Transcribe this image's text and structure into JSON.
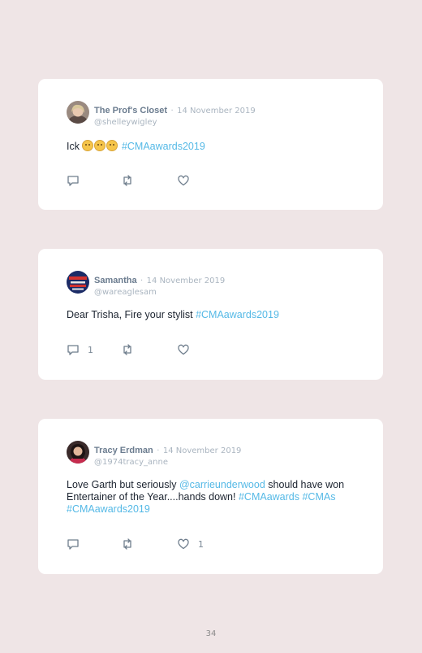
{
  "tweets": [
    {
      "name": "The Prof's Closet",
      "date": "14 November 2019",
      "handle": "@shelleywigley",
      "text_before": "Ick ",
      "emoji_names": [
        "confused-face-emoji",
        "confused-face-emoji",
        "confused-face-emoji"
      ],
      "hashtag": "#CMAawards2019",
      "reply_count": "",
      "retweet_count": "",
      "like_count": ""
    },
    {
      "name": "Samantha",
      "date": "14 November 2019",
      "handle": "@wareaglesam",
      "text_before": "Dear Trisha, Fire your stylist ",
      "hashtag": "#CMAawards2019",
      "reply_count": "1",
      "retweet_count": "",
      "like_count": ""
    },
    {
      "name": "Tracy Erdman",
      "date": "14 November 2019",
      "handle": "@1974tracy_anne",
      "text_1": "Love Garth but seriously ",
      "mention": "@carrieunderwood",
      "text_2": " should have won Entertainer of the Year....hands down! ",
      "hashtag_1": "#CMAawards",
      "hashtag_2": "#CMAs",
      "hashtag_3": "#CMAawards2019",
      "reply_count": "",
      "retweet_count": "",
      "like_count": "1"
    }
  ],
  "separator": "·",
  "page_number": "34",
  "colors": {
    "background": "#efe5e6",
    "link": "#55b9e6",
    "name": "#6b7c8f"
  }
}
